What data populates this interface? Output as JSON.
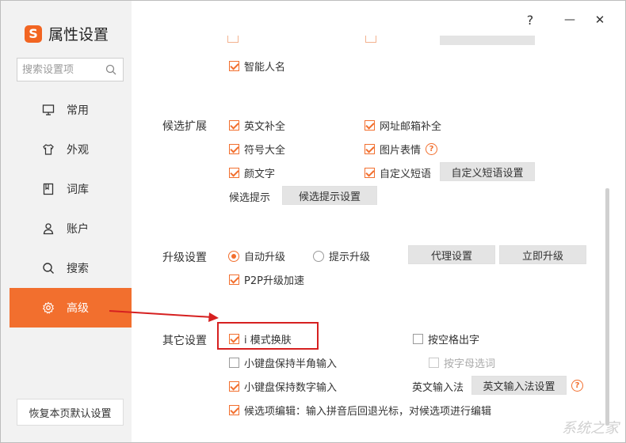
{
  "app": {
    "logo": "S",
    "title": "属性设置"
  },
  "window_controls": {
    "help": "?",
    "minimize": "—",
    "close": "✕"
  },
  "search": {
    "placeholder": "搜索设置项"
  },
  "nav": [
    {
      "label": "常用",
      "icon": "monitor-icon"
    },
    {
      "label": "外观",
      "icon": "shirt-icon"
    },
    {
      "label": "词库",
      "icon": "dictionary-icon"
    },
    {
      "label": "账户",
      "icon": "user-icon"
    },
    {
      "label": "搜索",
      "icon": "search-icon"
    },
    {
      "label": "高级",
      "icon": "gear-icon",
      "active": true
    }
  ],
  "reset_button": "恢复本页默认设置",
  "top_partial": {
    "smart_name": "智能人名"
  },
  "candidate_ext": {
    "label": "候选扩展",
    "english_complete": "英文补全",
    "url_email": "网址邮箱补全",
    "symbols": "符号大全",
    "emoji_pics": "图片表情",
    "kaomoji": "颜文字",
    "custom_phrases": "自定义短语",
    "custom_phrases_btn": "自定义短语设置",
    "hint_label": "候选提示",
    "hint_btn": "候选提示设置"
  },
  "upgrade": {
    "label": "升级设置",
    "auto": "自动升级",
    "prompt": "提示升级",
    "proxy_btn": "代理设置",
    "now_btn": "立即升级",
    "p2p": "P2P升级加速"
  },
  "other": {
    "label": "其它设置",
    "i_mode_skin": "i 模式换肤",
    "space_output": "按空格出字",
    "keypad_half": "小键盘保持半角输入",
    "letter_select": "按字母选词",
    "keypad_digit": "小键盘保持数字输入",
    "english_ime_label": "英文输入法",
    "english_ime_btn": "英文输入法设置",
    "candidate_edit": "候选项编辑：输入拼音后回退光标，对候选项进行编辑"
  },
  "watermark": "系统之家",
  "colors": {
    "accent": "#f26f2e",
    "sidebar": "#f2f2f2",
    "highlight": "#d62020"
  }
}
